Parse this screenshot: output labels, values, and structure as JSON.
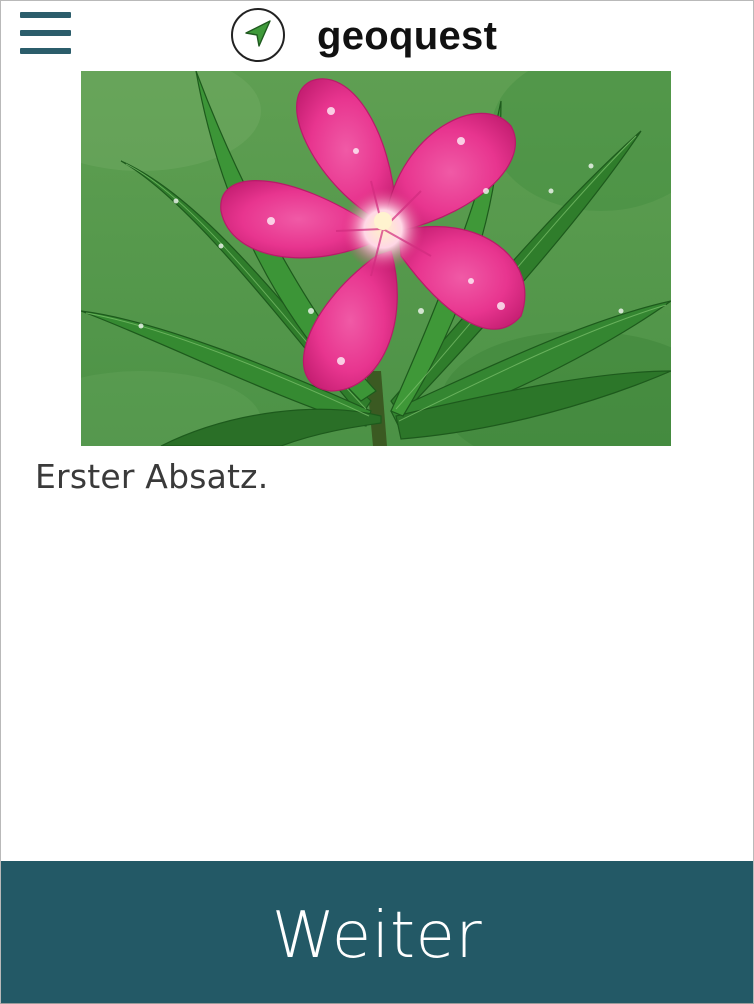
{
  "colors": {
    "accent": "#235966",
    "menu_icon": "#2b5d6b",
    "logo_arrow": "#3f9a3a",
    "button_text": "#ffffff",
    "petal": "#e8358f",
    "leaf": "#2f7d2b"
  },
  "header": {
    "menu_icon": "hamburger-menu-icon",
    "logo_icon": "navigation-arrow-icon",
    "title": "geoquest"
  },
  "content": {
    "image": {
      "subject": "pink flower with green leaves"
    },
    "paragraph": "Erster Absatz."
  },
  "footer": {
    "next_label": "Weiter"
  }
}
